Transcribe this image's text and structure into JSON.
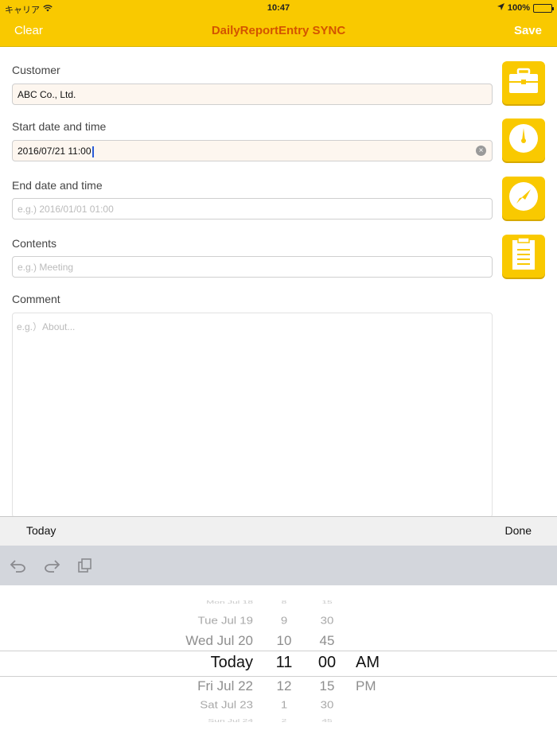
{
  "status_bar": {
    "carrier": "キャリア",
    "time": "10:47",
    "battery": "100%"
  },
  "nav": {
    "clear_label": "Clear",
    "title": "DailyReportEntry SYNC",
    "save_label": "Save"
  },
  "form": {
    "customer": {
      "label": "Customer",
      "value": "ABC Co., Ltd."
    },
    "start": {
      "label": "Start date and time",
      "value": "2016/07/21 11:00"
    },
    "end": {
      "label": "End date and time",
      "placeholder": "e.g.) 2016/01/01 01:00"
    },
    "contents": {
      "label": "Contents",
      "placeholder": "e.g.) Meeting"
    },
    "comment": {
      "label": "Comment",
      "placeholder": "e.g.）About..."
    }
  },
  "side_buttons": [
    {
      "icon": "briefcase-icon"
    },
    {
      "icon": "clock-start-icon"
    },
    {
      "icon": "clock-end-icon"
    },
    {
      "icon": "notepad-icon"
    }
  ],
  "accessory_bar": {
    "today_label": "Today",
    "done_label": "Done"
  },
  "keyboard_bar": {
    "icons": [
      "undo-icon",
      "redo-icon",
      "paste-icon"
    ]
  },
  "picker": {
    "dates": [
      "Mon Jul 18",
      "Tue Jul 19",
      "Wed Jul 20",
      "Today",
      "Fri Jul 22",
      "Sat Jul 23",
      "Sun Jul 24"
    ],
    "hours": [
      "8",
      "9",
      "10",
      "11",
      "12",
      "1",
      "2"
    ],
    "minutes": [
      "15",
      "30",
      "45",
      "00",
      "15",
      "30",
      "45"
    ],
    "ampm": [
      "AM",
      "PM"
    ],
    "selected": {
      "date": "Today",
      "hour": "11",
      "minute": "00",
      "ampm": "AM"
    }
  },
  "colors": {
    "accent": "#f9c900",
    "title": "#d35400",
    "field_filled_bg": "#fdf6ef"
  }
}
